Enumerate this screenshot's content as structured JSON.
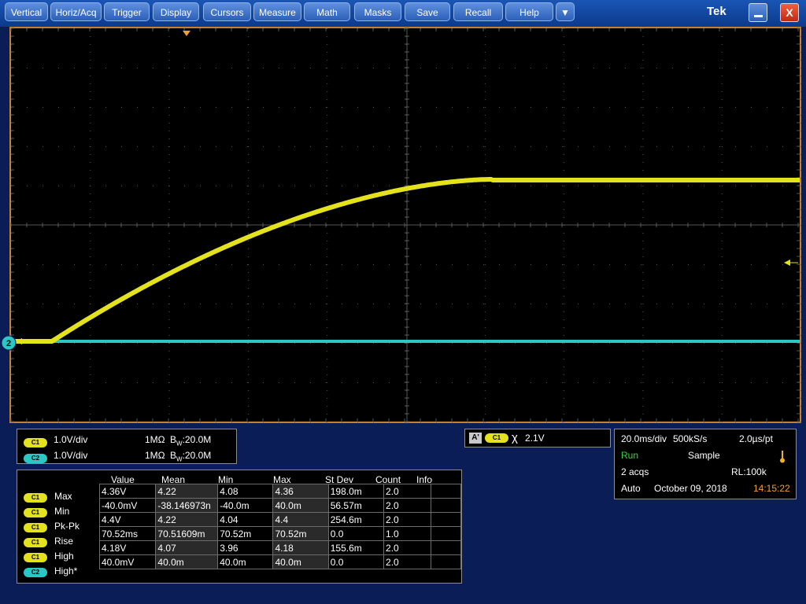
{
  "menu": {
    "items": [
      "Vertical",
      "Horiz/Acq",
      "Trigger",
      "Display",
      "Cursors",
      "Measure",
      "Math",
      "Masks",
      "Save",
      "Recall",
      "Help"
    ],
    "more_glyph": "▼",
    "brand": "Tek",
    "minimize_glyph": "_",
    "close_glyph": "X"
  },
  "channels": [
    {
      "badge": "C1",
      "scale": "1.0V/div",
      "impedance": "1MΩ",
      "bw_label": "B",
      "bw_sub": "W",
      "bw_value": ":20.0M",
      "color": "#e4e21c"
    },
    {
      "badge": "C2",
      "scale": "1.0V/div",
      "impedance": "1MΩ",
      "bw_label": "B",
      "bw_sub": "W",
      "bw_value": ":20.0M",
      "color": "#2ac7c5"
    }
  ],
  "trigger": {
    "source_label": "A'",
    "channel": "C1",
    "slope_glyph": "χ",
    "level": "2.1V"
  },
  "acquisition": {
    "timebase": "20.0ms/div",
    "sample_rate": "500kS/s",
    "resolution": "2.0µs/pt",
    "state": "Run",
    "mode": "Sample",
    "acqs": "2 acqs",
    "record_length": "RL:100k",
    "trigger_mode": "Auto",
    "date": "October 09, 2018",
    "time": "14:15:22"
  },
  "measurements": {
    "headers": [
      "Value",
      "Mean",
      "Min",
      "Max",
      "St Dev",
      "Count",
      "Info"
    ],
    "rows": [
      {
        "ch": "C1",
        "name": "Max",
        "values": [
          "4.36V",
          "4.22",
          "4.08",
          "4.36",
          "198.0m",
          "2.0",
          ""
        ]
      },
      {
        "ch": "C1",
        "name": "Min",
        "values": [
          "-40.0mV",
          "-38.146973n",
          "-40.0m",
          "40.0m",
          "56.57m",
          "2.0",
          ""
        ]
      },
      {
        "ch": "C1",
        "name": "Pk-Pk",
        "values": [
          "4.4V",
          "4.22",
          "4.04",
          "4.4",
          "254.6m",
          "2.0",
          ""
        ]
      },
      {
        "ch": "C1",
        "name": "Rise",
        "values": [
          "70.52ms",
          "70.51609m",
          "70.52m",
          "70.52m",
          "0.0",
          "1.0",
          ""
        ]
      },
      {
        "ch": "C1",
        "name": "High",
        "values": [
          "4.18V",
          "4.07",
          "3.96",
          "4.18",
          "155.6m",
          "2.0",
          ""
        ]
      },
      {
        "ch": "C2",
        "name": "High*",
        "values": [
          "40.0mV",
          "40.0m",
          "40.0m",
          "40.0m",
          "0.0",
          "2.0",
          ""
        ]
      }
    ]
  },
  "markers": {
    "ch2_marker": "2"
  },
  "colors": {
    "ch1": "#e4e21c",
    "ch2": "#2ac7c5",
    "frame": "#c8802a",
    "accent": "#f0a030"
  }
}
